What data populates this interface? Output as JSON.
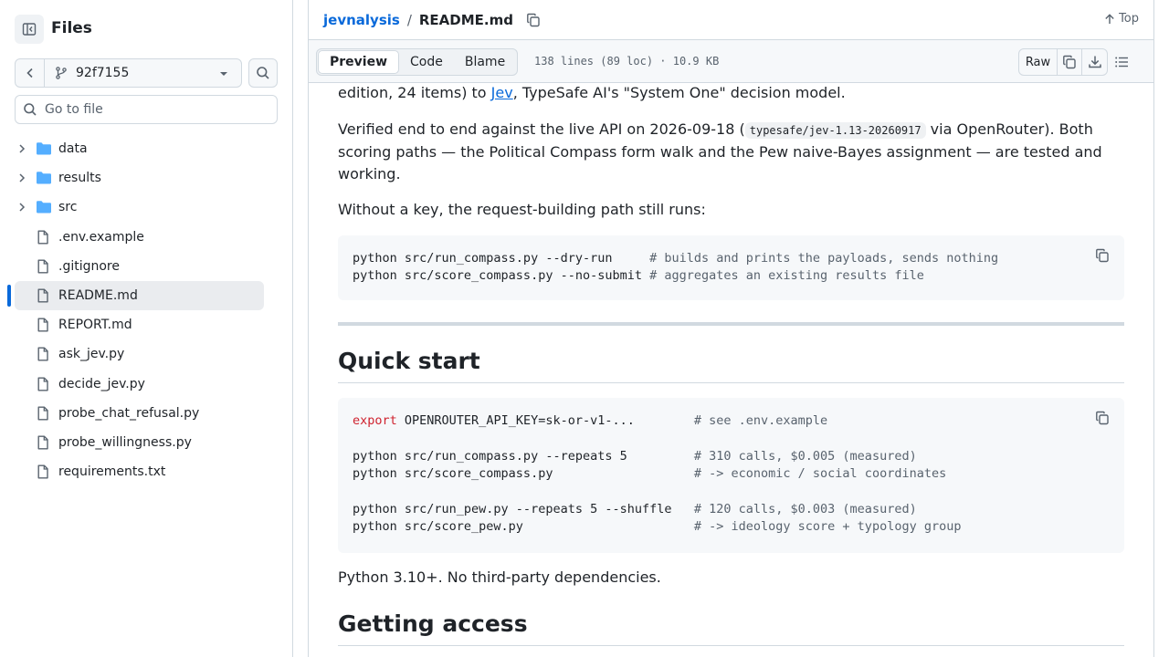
{
  "sidebar": {
    "title": "Files",
    "branch": "92f7155",
    "goto_placeholder": "Go to file",
    "items": [
      {
        "name": "data",
        "type": "folder"
      },
      {
        "name": "results",
        "type": "folder"
      },
      {
        "name": "src",
        "type": "folder"
      },
      {
        "name": ".env.example",
        "type": "file"
      },
      {
        "name": ".gitignore",
        "type": "file"
      },
      {
        "name": "README.md",
        "type": "file",
        "selected": true
      },
      {
        "name": "REPORT.md",
        "type": "file"
      },
      {
        "name": "ask_jev.py",
        "type": "file"
      },
      {
        "name": "decide_jev.py",
        "type": "file"
      },
      {
        "name": "probe_chat_refusal.py",
        "type": "file"
      },
      {
        "name": "probe_willingness.py",
        "type": "file"
      },
      {
        "name": "requirements.txt",
        "type": "file"
      }
    ]
  },
  "header": {
    "repo": "jevnalysis",
    "sep": "/",
    "file": "README.md",
    "top_label": "Top"
  },
  "toolbar": {
    "tabs": [
      "Preview",
      "Code",
      "Blame"
    ],
    "active_tab": "Preview",
    "meta": "138 lines (89 loc) · 10.9 KB",
    "raw_label": "Raw"
  },
  "content": {
    "p1_pre": "edition, 24 items) to ",
    "p1_link": "Jev",
    "p1_post": ", TypeSafe AI's \"System One\" decision model.",
    "p2_pre": "Verified end to end against the live API on 2026-09-18 (",
    "p2_code": "typesafe/jev-1.13-20260917",
    "p2_post": " via OpenRouter). Both scoring paths — the Political Compass form walk and the Pew naive-Bayes assignment — are tested and working.",
    "p3": "Without a key, the request-building path still runs:",
    "code1": [
      {
        "cmd": "python src/run_compass.py --dry-run     ",
        "comment": "# builds and prints the payloads, sends nothing"
      },
      {
        "cmd": "python src/score_compass.py --no-submit ",
        "comment": "# aggregates an existing results file"
      }
    ],
    "h2_quickstart": "Quick start",
    "code2": {
      "export_kw": "export",
      "export_rest": " OPENROUTER_API_KEY=sk-or-v1-...        ",
      "export_comment": "# see .env.example",
      "lines": [
        {
          "cmd": "python src/run_compass.py --repeats 5         ",
          "comment": "# 310 calls, $0.005 (measured)"
        },
        {
          "cmd": "python src/score_compass.py                   ",
          "comment": "# -> economic / social coordinates"
        },
        {
          "cmd": "",
          "comment": ""
        },
        {
          "cmd": "python src/run_pew.py --repeats 5 --shuffle   ",
          "comment": "# 120 calls, $0.003 (measured)"
        },
        {
          "cmd": "python src/score_pew.py                       ",
          "comment": "# -> ideology score + typology group"
        }
      ]
    },
    "p4": "Python 3.10+. No third-party dependencies.",
    "h2_access": "Getting access"
  }
}
